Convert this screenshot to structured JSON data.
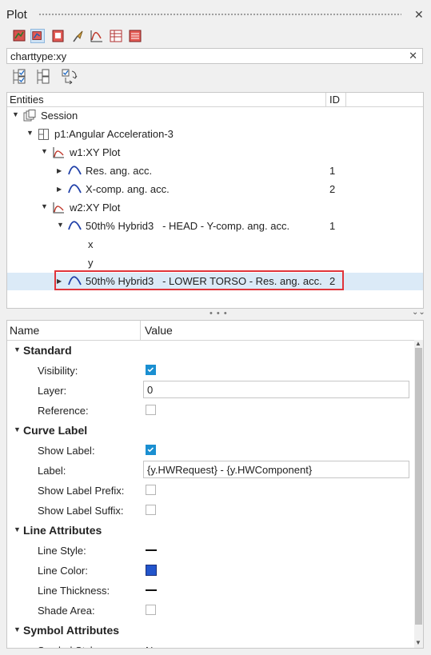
{
  "window": {
    "title": "Plot"
  },
  "toolbar": {
    "icons": [
      "plot-add-icon",
      "plot-select-icon",
      "plot-page-icon",
      "pin-icon",
      "chart-icon",
      "table-icon",
      "report-icon"
    ]
  },
  "search": {
    "value": "charttype:xy",
    "clear_label": "✕"
  },
  "tree_toolbar": {
    "icons": [
      "expand-all-icon",
      "collapse-all-icon",
      "sync-icon"
    ]
  },
  "tree": {
    "header": {
      "entities": "Entities",
      "id": "ID"
    },
    "rows": [
      {
        "label": "Session",
        "id": ""
      },
      {
        "label": "p1:Angular Acceleration-3",
        "id": ""
      },
      {
        "label": "w1:XY Plot",
        "id": ""
      },
      {
        "label": "Res. ang. acc.",
        "id": "1"
      },
      {
        "label": "X-comp. ang. acc.",
        "id": "2"
      },
      {
        "label": "w2:XY Plot",
        "id": ""
      },
      {
        "label": "50th% Hybrid3   - HEAD - Y-comp. ang. acc.",
        "id": "1"
      },
      {
        "label": "x",
        "id": ""
      },
      {
        "label": "y",
        "id": ""
      },
      {
        "label": "50th% Hybrid3   - LOWER TORSO - Res. ang. acc.",
        "id": "2"
      }
    ]
  },
  "splitter_label": "• • •",
  "props": {
    "header": {
      "name": "Name",
      "value": "Value"
    },
    "standard": {
      "title": "Standard",
      "visibility": "Visibility:",
      "layer": "Layer:",
      "layer_value": "0",
      "reference": "Reference:"
    },
    "curve_label": {
      "title": "Curve Label",
      "show_label": "Show Label:",
      "label": "Label:",
      "label_value": "{y.HWRequest} - {y.HWComponent}",
      "show_prefix": "Show Label Prefix:",
      "show_suffix": "Show Label Suffix:"
    },
    "line_attributes": {
      "title": "Line Attributes",
      "line_style": "Line Style:",
      "line_color": "Line Color:",
      "line_color_value": "#2255cc",
      "line_thickness": "Line Thickness:",
      "shade_area": "Shade Area:"
    },
    "symbol_attributes": {
      "title": "Symbol Attributes",
      "symbol_style": "Symbol Style:",
      "symbol_style_value": "N"
    }
  }
}
